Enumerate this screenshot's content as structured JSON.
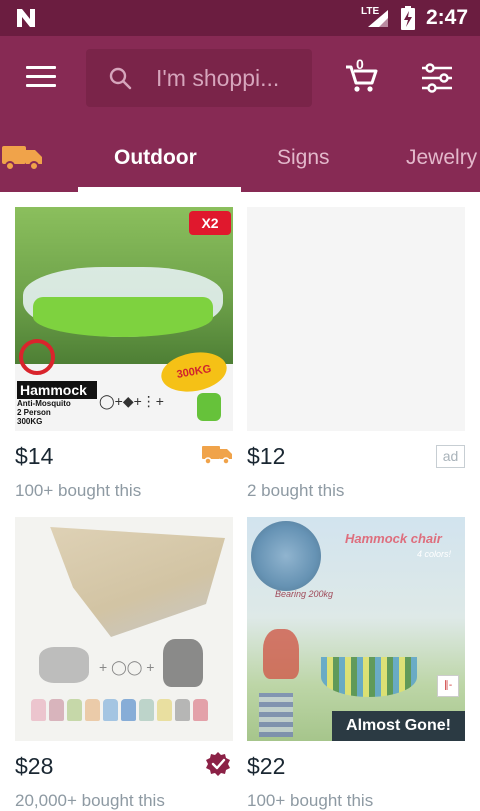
{
  "status_bar": {
    "time": "2:47",
    "network": "LTE",
    "icons": [
      "n-logo-icon",
      "signal-icon",
      "battery-charging-icon"
    ]
  },
  "app_bar": {
    "search_placeholder": "I'm shoppi...",
    "cart_count": "0",
    "icons": [
      "menu-icon",
      "search-icon",
      "cart-icon",
      "filter-icon"
    ]
  },
  "tabs": [
    {
      "label": "",
      "icon": "truck-icon"
    },
    {
      "label": "Outdoor",
      "active": true
    },
    {
      "label": "Signs"
    },
    {
      "label": "Jewelry"
    }
  ],
  "products": [
    {
      "price": "$14",
      "bought": "100+ bought this",
      "badge": "truck-icon",
      "image_text": {
        "badge": "X2",
        "label": "Hammock",
        "features": [
          "Anti-Mosquito",
          "2 Person",
          "300KG"
        ],
        "weight": "300KG"
      }
    },
    {
      "price": "$12",
      "bought": "2 bought this",
      "badge": "ad",
      "ad_label": "ad"
    },
    {
      "price": "$28",
      "bought": "20,000+ bought this",
      "badge": "verified-icon"
    },
    {
      "price": "$22",
      "bought": "100+ bought this",
      "overlay": "Almost Gone!",
      "image_text": {
        "title": "Hammock chair",
        "subtitle": "4 colors!",
        "caption": "Bearing 200kg"
      }
    }
  ],
  "colors": {
    "status_bar": "#6b1d40",
    "app_bar": "#872a54",
    "accent_orange": "#f0a34a",
    "verified": "#8b2146"
  }
}
